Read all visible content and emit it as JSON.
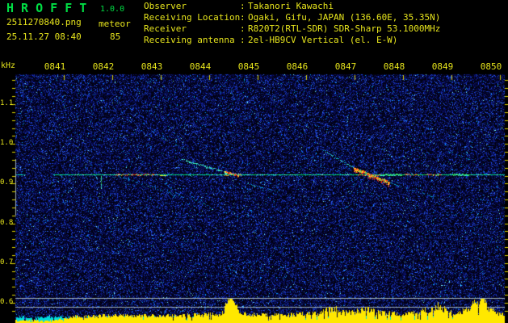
{
  "header": {
    "app_name": "H R O F F T",
    "app_version": "1.0.0",
    "file_name": "2511270840.png",
    "mode": "meteor",
    "datetime": "25.11.27 08:40",
    "count": "85",
    "colon": ":",
    "info_rows": [
      {
        "label": "Observer",
        "value": "Takanori Kawachi"
      },
      {
        "label": "Receiving Location",
        "value": "Ogaki, Gifu, JAPAN (136.60E, 35.35N)"
      },
      {
        "label": "Receiver",
        "value": "R820T2(RTL-SDR) SDR-Sharp 53.1000MHz"
      },
      {
        "label": "Receiving antenna",
        "value": "2el-HB9CV Vertical (el. E-W)"
      }
    ]
  },
  "chart_data": {
    "type": "heatmap",
    "subtype": "radio-meteor-spectrogram",
    "x_axis": {
      "tick_labels": [
        "0841",
        "0842",
        "0843",
        "0844",
        "0845",
        "0846",
        "0847",
        "0848",
        "0849",
        "0850"
      ],
      "start_time": "0840",
      "seconds_per_pixel": 1,
      "span_seconds": 606
    },
    "y_axis": {
      "unit": "kHz",
      "tick_labels": [
        "1.1",
        "1.0",
        "0.9",
        "0.8",
        "0.7",
        "0.6"
      ],
      "tick_values": [
        1.1,
        1.0,
        0.9,
        0.8,
        0.7,
        0.6
      ],
      "minor_tick_khz": 0.02,
      "range_khz": [
        0.575,
        1.175
      ]
    },
    "carrier_line": {
      "frequency_khz": 0.923,
      "t_start_s": 47,
      "t_end_s": 606,
      "lead_in": {
        "t0": 1,
        "t1": 11
      },
      "bright_segments": [
        {
          "t0": 124,
          "t1": 171,
          "style": "red"
        },
        {
          "t0": 171,
          "t1": 186,
          "style": "yellow"
        },
        {
          "t0": 259,
          "t1": 279,
          "style": "red"
        },
        {
          "t0": 424,
          "t1": 451,
          "style": "red"
        },
        {
          "t0": 451,
          "t1": 478,
          "style": "green"
        },
        {
          "t0": 481,
          "t1": 499,
          "style": "red"
        },
        {
          "t0": 508,
          "t1": 526,
          "style": "red"
        },
        {
          "t0": 541,
          "t1": 561,
          "style": "green"
        }
      ]
    },
    "echo_traces": [
      {
        "t0": 128,
        "f0": 0.919,
        "t1": 234,
        "f1": 0.85,
        "intensity": "faint"
      },
      {
        "t0": 184,
        "f0": 0.905,
        "t1": 203,
        "f1": 0.87,
        "intensity": "faint"
      },
      {
        "t0": 206,
        "f0": 0.962,
        "t1": 271,
        "f1": 0.923,
        "intensity": "bright"
      },
      {
        "t0": 259,
        "f0": 0.931,
        "t1": 276,
        "f1": 0.921,
        "intensity": "strong-red"
      },
      {
        "t0": 286,
        "f0": 0.901,
        "t1": 326,
        "f1": 0.878,
        "intensity": "faint"
      },
      {
        "t0": 181,
        "f0": 1.017,
        "t1": 209,
        "f1": 0.988,
        "intensity": "faint"
      },
      {
        "t0": 381,
        "f0": 0.984,
        "t1": 419,
        "f1": 0.939,
        "intensity": "medium"
      },
      {
        "t0": 419,
        "f0": 0.939,
        "t1": 463,
        "f1": 0.903,
        "intensity": "strong-blob"
      },
      {
        "t0": 463,
        "f0": 0.903,
        "t1": 529,
        "f1": 0.86,
        "intensity": "faint"
      },
      {
        "t0": 536,
        "f0": 0.98,
        "t1": 571,
        "f1": 0.956,
        "intensity": "faint"
      },
      {
        "t0": 106,
        "f0": 0.919,
        "t1": 106,
        "f1": 0.89,
        "intensity": "green-dash"
      }
    ],
    "reference_lines": {
      "vertical_khz": [
        0.962,
        0.82
      ],
      "horizontal_khz": [
        0.612,
        0.59
      ]
    },
    "level_bars": {
      "unit": "px",
      "max_height": 30,
      "control_points": [
        [
          0,
          3
        ],
        [
          45,
          3
        ],
        [
          58,
          5
        ],
        [
          75,
          8
        ],
        [
          120,
          9
        ],
        [
          200,
          9
        ],
        [
          240,
          10
        ],
        [
          256,
          12
        ],
        [
          262,
          24
        ],
        [
          267,
          29
        ],
        [
          272,
          20
        ],
        [
          282,
          12
        ],
        [
          300,
          10
        ],
        [
          330,
          10
        ],
        [
          370,
          11
        ],
        [
          388,
          16
        ],
        [
          395,
          19
        ],
        [
          402,
          14
        ],
        [
          415,
          12
        ],
        [
          428,
          16
        ],
        [
          435,
          20
        ],
        [
          442,
          15
        ],
        [
          455,
          12
        ],
        [
          475,
          11
        ],
        [
          495,
          13
        ],
        [
          512,
          16
        ],
        [
          523,
          21
        ],
        [
          532,
          16
        ],
        [
          540,
          13
        ],
        [
          552,
          14
        ],
        [
          562,
          18
        ],
        [
          570,
          24
        ],
        [
          578,
          28
        ],
        [
          585,
          20
        ],
        [
          592,
          14
        ],
        [
          600,
          12
        ],
        [
          606,
          11
        ]
      ]
    }
  },
  "colors": {
    "background": "#000000",
    "text_yellow": "#e6e41c",
    "text_green": "#00dd44",
    "axis_tick": "#ded400",
    "ref_gray": "#9fb0b8",
    "noise_palette": [
      "#020210",
      "#05073a",
      "#0a1070",
      "#1530ae",
      "#2048e8",
      "#2e6aff",
      "#00a8ff",
      "#7cffff"
    ],
    "carrier_colors": [
      "#00c85a",
      "#00e0b4",
      "#40ffd0",
      "#b4ffe8"
    ],
    "echo_cyan": "#00a4cc",
    "echo_faint": "#0878b0",
    "echo_bright": "#38e8c4",
    "strong_red": "#ff3010",
    "strong_orange": "#ff8830",
    "strong_yellow": "#ffe020",
    "strong_green": "#2ee060",
    "level_bar_yellow": "#ffe800",
    "level_bar_cyan": "#00dcdc"
  }
}
